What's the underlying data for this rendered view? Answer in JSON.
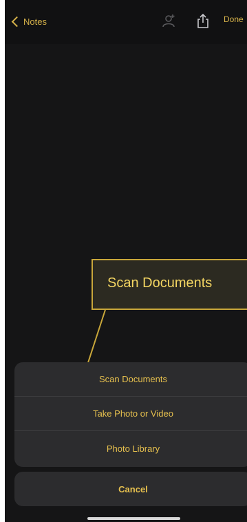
{
  "nav": {
    "back_label": "Notes",
    "done_label": "Done",
    "icons": [
      "add-person-icon",
      "share-icon"
    ]
  },
  "callout": {
    "label": "Scan Documents",
    "color": "#c9a73a"
  },
  "action_sheet": {
    "items": [
      {
        "label": "Scan Documents"
      },
      {
        "label": "Take Photo or Video"
      },
      {
        "label": "Photo Library"
      }
    ],
    "cancel_label": "Cancel"
  },
  "colors": {
    "accent": "#e6c04e",
    "background": "#1c1c1e",
    "sheet": "#2c2c2e"
  }
}
